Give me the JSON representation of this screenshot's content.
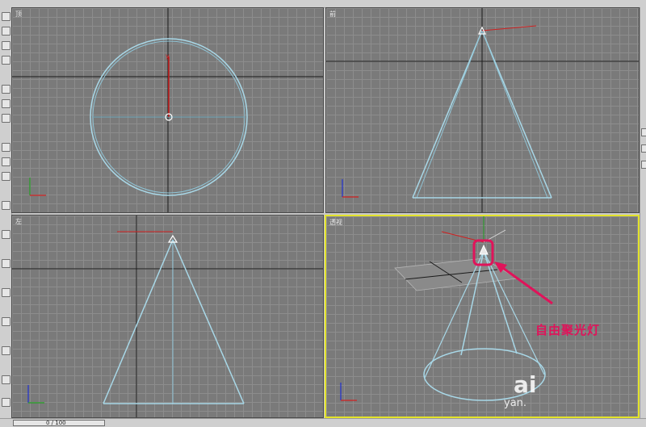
{
  "viewports": {
    "top": {
      "label": "顶"
    },
    "front": {
      "label": "前"
    },
    "left": {
      "label": "左"
    },
    "perspective": {
      "label": "透视"
    }
  },
  "annotation": {
    "label": "自由聚光灯"
  },
  "watermark": {
    "line1": "ai",
    "line2": "yan."
  },
  "statusbar": {
    "time_slider": "0 / 100"
  },
  "colors": {
    "viewport_bg": "#7a7a7a",
    "grid": "#8d8d8d",
    "light_cone": "#a8d8e8",
    "active_border": "#e3e32a",
    "annotation": "#e0135a",
    "axis_x": "#d02020",
    "axis_y": "#20a020",
    "axis_z": "#2030d0"
  },
  "icons": [
    "select-icon",
    "move-icon",
    "rotate-icon",
    "scale-icon",
    "link-icon",
    "unlink-icon",
    "bind-icon",
    "snap-icon",
    "mirror-icon",
    "align-icon"
  ]
}
